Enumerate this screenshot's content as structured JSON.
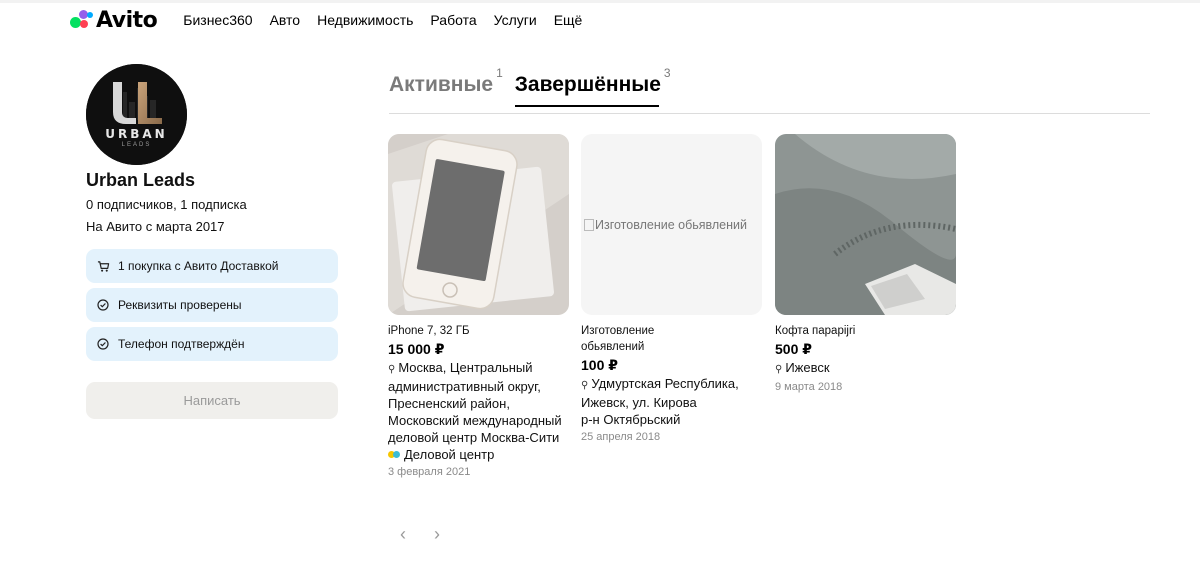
{
  "header": {
    "logo_text": "Avito",
    "nav": [
      "Бизнес360",
      "Авто",
      "Недвижимость",
      "Работа",
      "Услуги",
      "Ещё"
    ]
  },
  "profile": {
    "avatar_text": "UL",
    "avatar_sub1": "URBAN",
    "avatar_sub2": "LEADS",
    "name": "Urban Leads",
    "subscriptions": "0 подписчиков, 1 подписка",
    "since": "На Авито с марта 2017",
    "badges": [
      {
        "icon": "cart-icon",
        "label": "1 покупка с Авито Доставкой"
      },
      {
        "icon": "check-circle-icon",
        "label": "Реквизиты проверены"
      },
      {
        "icon": "check-circle-icon",
        "label": "Телефон подтверждён"
      }
    ],
    "write_button": "Написать"
  },
  "tabs": [
    {
      "label": "Активные",
      "count": "1",
      "active": false
    },
    {
      "label": "Завершённые",
      "count": "3",
      "active": true
    }
  ],
  "listings": [
    {
      "title": "iPhone 7, 32 ГБ",
      "price": "15 000 ₽",
      "address": "Москва, Центральный административный округ, Пресненский район, Московский международный деловой центр Москва-Сити",
      "metro": "Деловой центр",
      "date": "3 февраля 2021"
    },
    {
      "image_alt": "Изготовление обьявлений",
      "title": "Изготовление обьявлений",
      "price": "100 ₽",
      "address": "Удмуртская Республика, Ижевск, ул. Кирова",
      "district": "р-н Октябрьский",
      "date": "25 апреля 2018"
    },
    {
      "title": "Кофта парарijri",
      "price": "500 ₽",
      "address": "Ижевск",
      "date": "9 марта 2018"
    }
  ],
  "pager": {
    "prev": "‹",
    "next": "›"
  },
  "colors": {
    "badge_bg": "#e3f2fc",
    "button_bg": "#f0efec",
    "metro_dot_1": "#f7c600",
    "metro_dot_2": "#3dbcd6"
  }
}
